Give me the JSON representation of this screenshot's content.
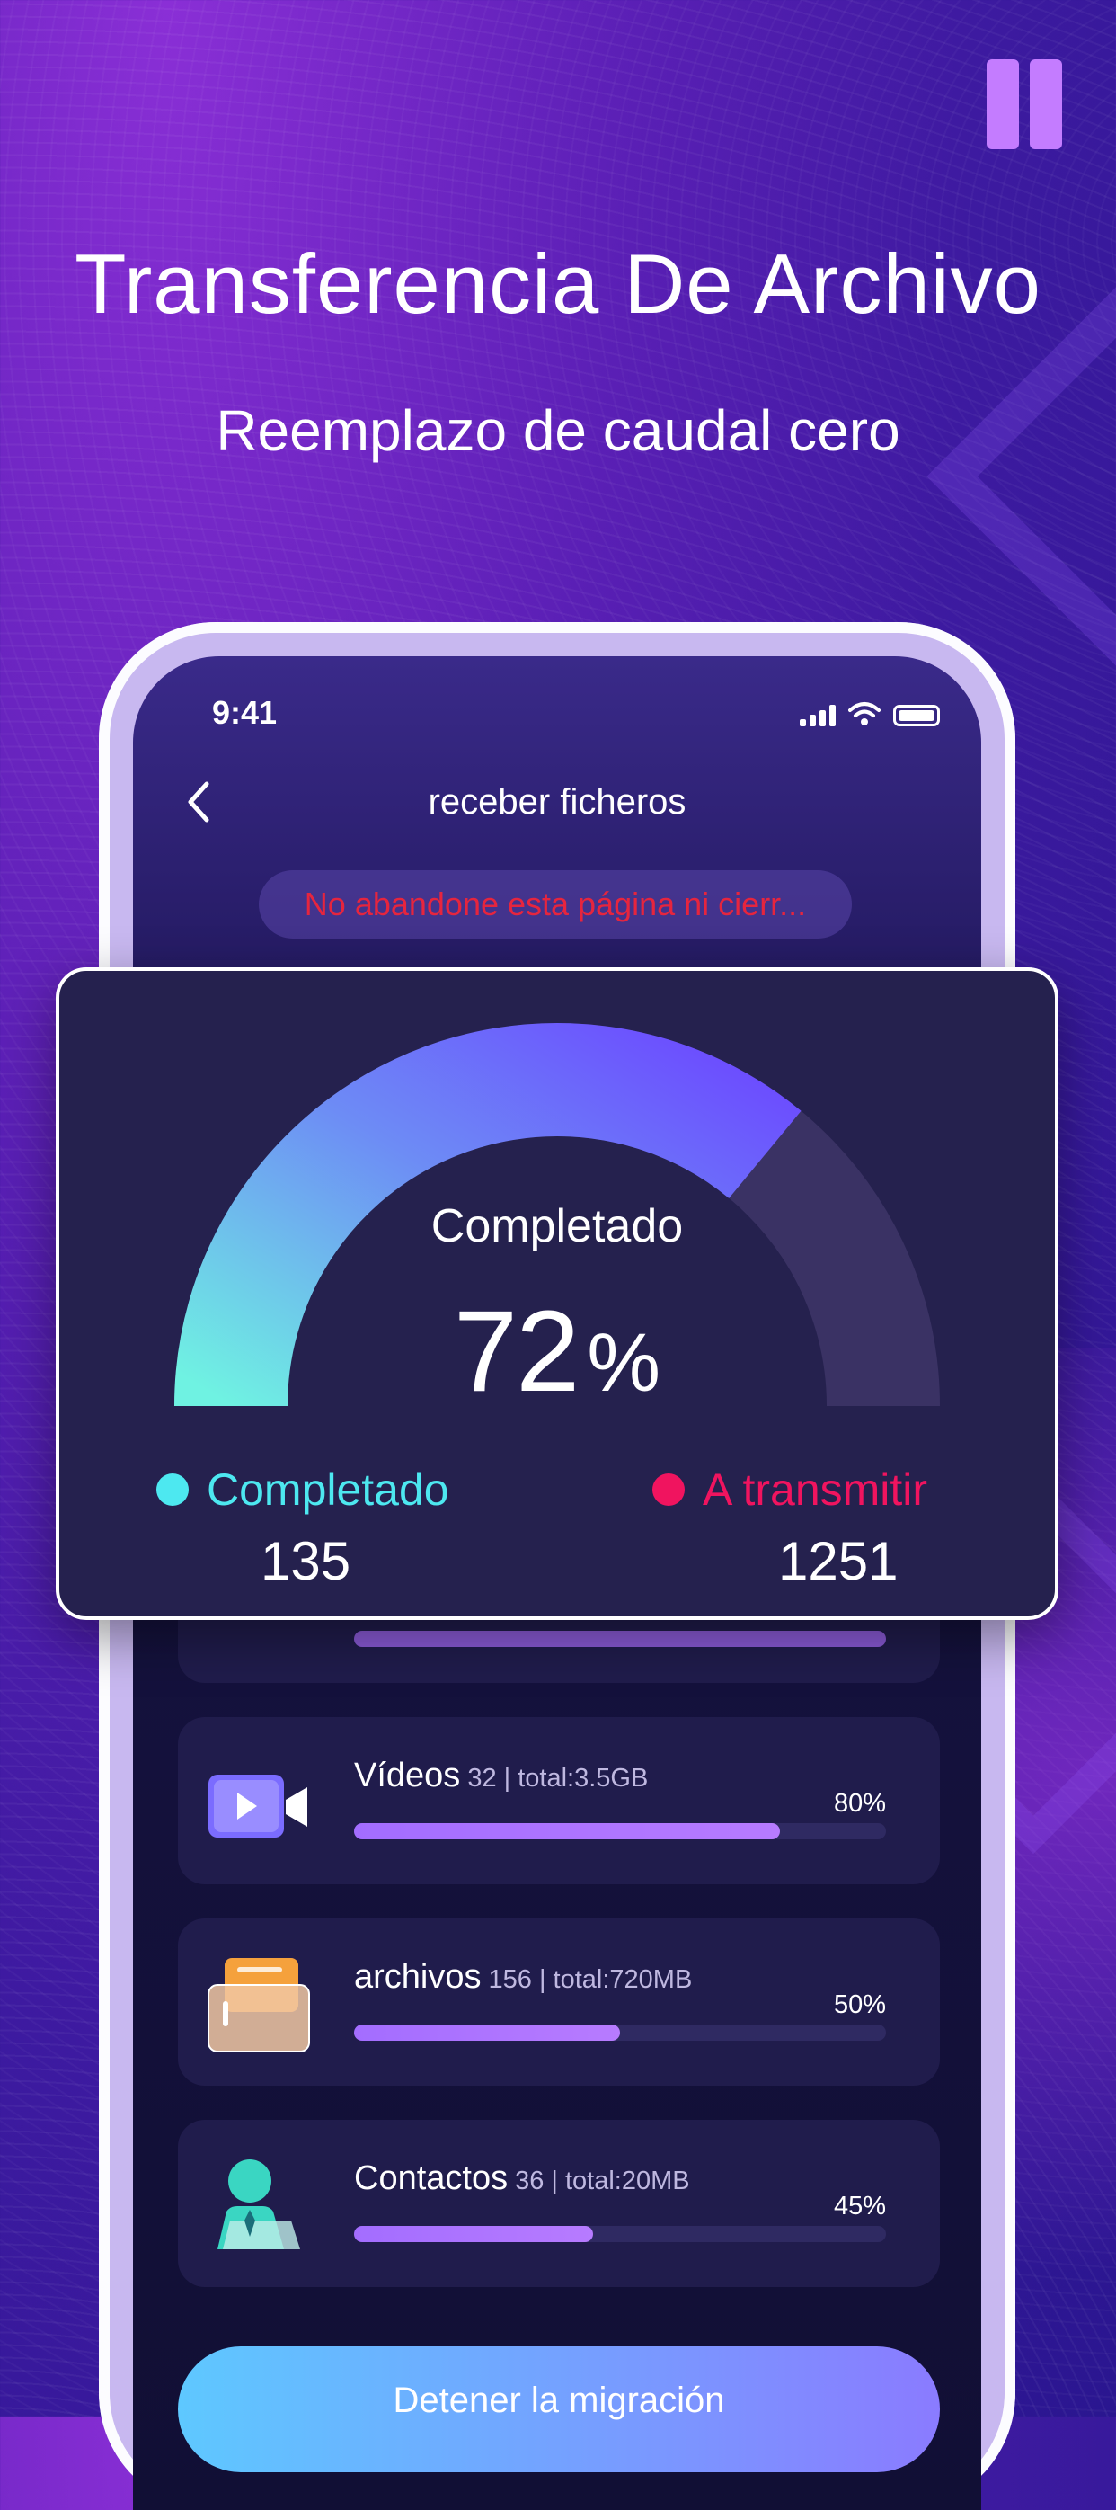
{
  "hero": {
    "title": "Transferencia De Archivo",
    "subtitle": "Reemplazo de caudal cero"
  },
  "status_bar": {
    "time": "9:41"
  },
  "nav": {
    "title": "receber ficheros"
  },
  "warning": {
    "text": "No abandone esta página ni cierr..."
  },
  "progress": {
    "label": "Completado",
    "value": 72,
    "unit": "%"
  },
  "legend": {
    "completed_label": "Completado",
    "completed_count": "135",
    "completed_color": "#4de8f0",
    "pending_label": "A transmitir",
    "pending_count": "1251",
    "pending_color": "#f0145f"
  },
  "files": [
    {
      "name": "Vídeos",
      "meta": "32 | total:3.5GB",
      "percent_label": "80%",
      "percent": 80,
      "icon": "video-camera-icon"
    },
    {
      "name": "archivos",
      "meta": "156 | total:720MB",
      "percent_label": "50%",
      "percent": 50,
      "icon": "folder-icon"
    },
    {
      "name": "Contactos",
      "meta": "36 | total:20MB",
      "percent_label": "45%",
      "percent": 45,
      "icon": "contact-person-icon"
    }
  ],
  "actions": {
    "stop_label": "Detener la migración"
  },
  "colors": {
    "accent": "#6b5cff",
    "gauge_start": "#6ff2e2",
    "gauge_end": "#6c4dff",
    "gauge_track": "#3a3264",
    "warning_text": "#e6253e"
  }
}
